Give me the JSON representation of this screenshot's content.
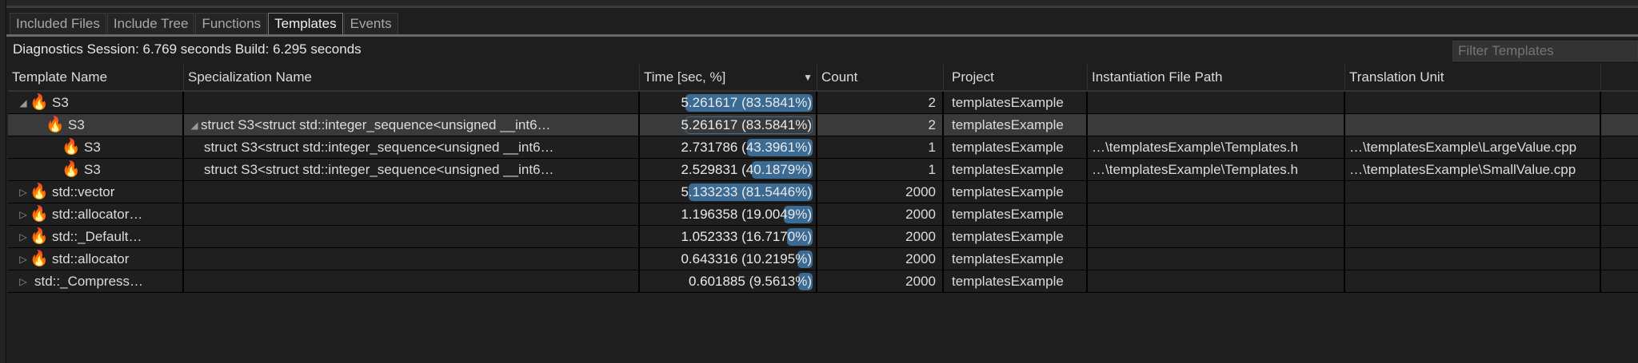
{
  "tabs": [
    "Included Files",
    "Include Tree",
    "Functions",
    "Templates",
    "Events"
  ],
  "active_tab": "Templates",
  "info": "Diagnostics Session: 6.769 seconds  Build: 6.295 seconds",
  "filter_placeholder": "Filter Templates",
  "columns": [
    "Template Name",
    "Specialization Name",
    "Time [sec, %]",
    "Count",
    "Project",
    "Instantiation File Path",
    "Translation Unit"
  ],
  "accent": "#3b6a93",
  "rows": [
    {
      "indent": 0,
      "expander": "expanded",
      "icon": "flame-icon",
      "name": "S3",
      "spec": "",
      "time": "5.261617 (83.5841%)",
      "pct": 83.5841,
      "count": "2",
      "project": "templatesExample",
      "file": "",
      "tu": ""
    },
    {
      "indent": 1,
      "expander": "none",
      "icon": "flame-icon",
      "name": "S3",
      "spec_expander": "expanded",
      "spec": "struct S3<struct std::integer_sequence<unsigned __int6…",
      "time": "5.261617 (83.5841%)",
      "pct": 83.5841,
      "count": "2",
      "project": "templatesExample",
      "file": "",
      "tu": "",
      "selected": true
    },
    {
      "indent": 2,
      "expander": "none",
      "icon": "flame-icon",
      "name": "S3",
      "spec": "struct S3<struct std::integer_sequence<unsigned __int6…",
      "time": "2.731786 (43.3961%)",
      "pct": 43.3961,
      "count": "1",
      "project": "templatesExample",
      "file": "…\\templatesExample\\Templates.h",
      "tu": "…\\templatesExample\\LargeValue.cpp"
    },
    {
      "indent": 2,
      "expander": "none",
      "icon": "flame-icon",
      "name": "S3",
      "spec": "struct S3<struct std::integer_sequence<unsigned __int6…",
      "time": "2.529831 (40.1879%)",
      "pct": 40.1879,
      "count": "1",
      "project": "templatesExample",
      "file": "…\\templatesExample\\Templates.h",
      "tu": "…\\templatesExample\\SmallValue.cpp"
    },
    {
      "indent": 0,
      "expander": "collapsed",
      "icon": "flame-icon",
      "name": "std::vector",
      "spec": "",
      "time": "5.133233 (81.5446%)",
      "pct": 81.5446,
      "count": "2000",
      "project": "templatesExample",
      "file": "",
      "tu": ""
    },
    {
      "indent": 0,
      "expander": "collapsed",
      "icon": "flame-icon",
      "name": "std::allocator…",
      "spec": "",
      "time": "1.196358 (19.0049%)",
      "pct": 19.0049,
      "count": "2000",
      "project": "templatesExample",
      "file": "",
      "tu": ""
    },
    {
      "indent": 0,
      "expander": "collapsed",
      "icon": "flame-icon",
      "name": "std::_Default…",
      "spec": "",
      "time": "1.052333 (16.7170%)",
      "pct": 16.717,
      "count": "2000",
      "project": "templatesExample",
      "file": "",
      "tu": ""
    },
    {
      "indent": 0,
      "expander": "collapsed",
      "icon": "flame-icon",
      "name": "std::allocator",
      "spec": "",
      "time": "0.643316 (10.2195%)",
      "pct": 10.2195,
      "count": "2000",
      "project": "templatesExample",
      "file": "",
      "tu": ""
    },
    {
      "indent": 0,
      "expander": "collapsed",
      "icon": "",
      "name": "std::_Compress…",
      "spec": "",
      "time": "0.601885 (9.5613%)",
      "pct": 9.5613,
      "count": "2000",
      "project": "templatesExample",
      "file": "",
      "tu": ""
    }
  ]
}
